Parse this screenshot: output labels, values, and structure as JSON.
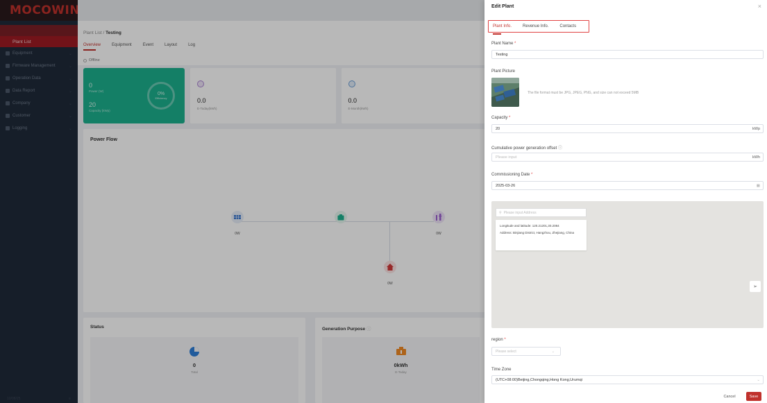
{
  "app": {
    "logo": "MOCOWINI"
  },
  "sidebar": {
    "active_item": "Plant List",
    "items": [
      {
        "label": "Equipment",
        "icon": "device-icon"
      },
      {
        "label": "Firmware Management",
        "icon": "firmware-icon"
      },
      {
        "label": "Operation Data",
        "icon": "chart-icon"
      },
      {
        "label": "Data Report",
        "icon": "report-icon"
      },
      {
        "label": "Company",
        "icon": "company-icon"
      },
      {
        "label": "Customer",
        "icon": "customer-icon"
      },
      {
        "label": "Logging",
        "icon": "log-icon"
      }
    ],
    "footer": "10/08/25"
  },
  "page": {
    "breadcrumb_root": "Plant List /",
    "breadcrumb_current": "Testing",
    "tabs": [
      "Overview",
      "Equipment",
      "Event",
      "Layout",
      "Log"
    ],
    "status": "Offline",
    "green_card": {
      "power_value": "0",
      "power_label": "Power (W)",
      "capacity_value": "20",
      "capacity_label": "Capacity (kWp)",
      "efficiency_value": "0%",
      "efficiency_label": "Efficiency"
    },
    "stat_cards": [
      {
        "value": "0.0",
        "label": "E-Today(kWh)"
      },
      {
        "value": "0.0",
        "label": "E-Month(kWh)"
      }
    ],
    "power_flow": {
      "title": "Power Flow",
      "pv": "0W",
      "grid": "0W",
      "load": "0W"
    },
    "status_card": {
      "title": "Status",
      "value": "0",
      "label": "Total"
    },
    "gen_card": {
      "title": "Generation Purpose",
      "value": "0kWh",
      "label": "E-Today"
    }
  },
  "drawer": {
    "title": "Edit Plant",
    "tabs": [
      "Plant Info.",
      "Revenue Info.",
      "Contacts"
    ],
    "plant_name": {
      "label": "Plant Name",
      "value": "Testing"
    },
    "plant_picture": {
      "label": "Plant Picture",
      "hint": "The file format must be JPG, JPEG, PNG, and size can not exceed 5MB"
    },
    "capacity": {
      "label": "Capacity",
      "value": "20",
      "unit": "kWp"
    },
    "offset": {
      "label": "Cumulative power generation offset",
      "placeholder": "Please input",
      "unit": "kWh"
    },
    "commissioning": {
      "label": "Commissioning Date",
      "value": "2025-03-26"
    },
    "map": {
      "search_placeholder": "Please input Address",
      "coords": "Longitude and latitude:  120.21201,30.2084",
      "address": "Address:  Binjiang District, Hangzhou, Zhejiang, China"
    },
    "region": {
      "label": "region",
      "placeholder": "Please select"
    },
    "timezone": {
      "label": "Time Zone",
      "value": "(UTC+08:00)Beijing,Chongqing,Hong Kong,Urumqi"
    },
    "cancel": "Cancel",
    "save": "Save"
  },
  "colors": {
    "accent": "#c0312c",
    "green": "#1cb08e"
  }
}
